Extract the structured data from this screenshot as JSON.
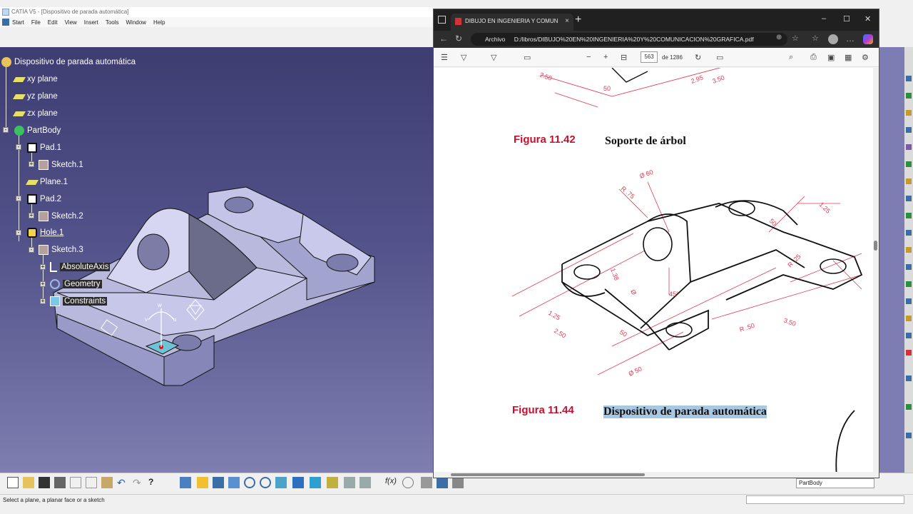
{
  "catia": {
    "window_title": "CATIA V5 - [Dispositivo de parada automática]",
    "menu": [
      "Start",
      "File",
      "Edit",
      "View",
      "Insert",
      "Tools",
      "Window",
      "Help"
    ],
    "tree": {
      "root": "Dispositivo de parada automática",
      "items": [
        "xy plane",
        "yz plane",
        "zx plane",
        "PartBody",
        "Pad.1",
        "Sketch.1",
        "Plane.1",
        "Pad.2",
        "Sketch.2",
        "Hole.1",
        "Sketch.3",
        "AbsoluteAxis",
        "Geometry",
        "Constraints"
      ]
    },
    "compass_labels": {
      "w": "w",
      "v": "v",
      "u": "u"
    },
    "workbench_combo": "PartBody",
    "status_text": "Select a plane, a planar face or a sketch"
  },
  "browser": {
    "tab_title": "DIBUJO EN INGENIERIA Y COMUN",
    "tab_close": "×",
    "new_tab": "+",
    "window_controls": {
      "min": "–",
      "max": "☐",
      "close": "✕"
    },
    "address_prefix": "Archivo",
    "url": "D:/libros/DIBUJO%20EN%20INGENIERIA%20Y%20COMUNICACION%20GRAFICA.pdf",
    "page_current": "563",
    "page_total": "de 1286"
  },
  "pdf": {
    "figure1_label": "Figura 11.42",
    "figure1_title": "Soporte de árbol",
    "figure2_label": "Figura 11.44",
    "figure2_title": "Dispositivo de parada automática",
    "top_dims": [
      "2.50",
      "50",
      "2.95",
      "3.50"
    ],
    "dims": [
      "Ø 60",
      "R .75",
      "1.25",
      "50",
      "1.38",
      "Ø",
      "45°",
      "R .25",
      "R .50",
      "3.50",
      "1.25",
      "2.50",
      "50",
      "Ø 50"
    ]
  },
  "colors": {
    "viewport_top": "#3d3d72",
    "viewport_bottom": "#7e7eb0",
    "fig_label": "#c8102e",
    "highlight": "#a7c7e2",
    "dim_red": "#e0394f"
  }
}
